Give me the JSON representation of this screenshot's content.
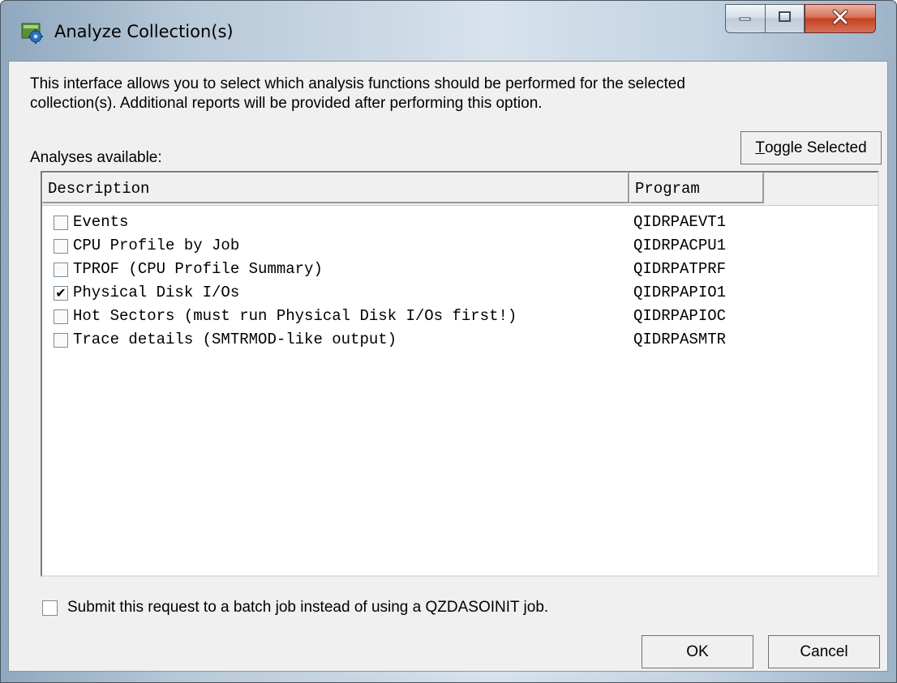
{
  "window": {
    "title": "Analyze Collection(s)",
    "icon": "analyze-gear-icon"
  },
  "caption_buttons": {
    "minimize": "minimize-icon",
    "maximize": "maximize-icon",
    "close": "close-icon"
  },
  "intro": {
    "line1": "This interface allows you to select which analysis functions should be performed for the selected",
    "line2": "collection(s).  Additional reports will be provided after performing this option."
  },
  "analyses_label": "Analyses available:",
  "toggle_button": {
    "underline": "T",
    "rest": "oggle Selected"
  },
  "list": {
    "columns": [
      "Description",
      "Program"
    ],
    "rows": [
      {
        "checked": false,
        "description": "Events",
        "program": "QIDRPAEVT1"
      },
      {
        "checked": false,
        "description": "CPU Profile by Job",
        "program": "QIDRPACPU1"
      },
      {
        "checked": false,
        "description": "TPROF (CPU Profile Summary)",
        "program": "QIDRPATPRF"
      },
      {
        "checked": true,
        "description": "Physical Disk I/Os",
        "program": "QIDRPAPIO1"
      },
      {
        "checked": false,
        "description": "Hot Sectors (must run Physical Disk I/Os first!)",
        "program": "QIDRPAPIOC"
      },
      {
        "checked": false,
        "description": "Trace details (SMTRMOD-like output)",
        "program": "QIDRPASMTR"
      }
    ]
  },
  "batch_option": {
    "checked": false,
    "label": "Submit this request to a batch job instead of using a QZDASOINIT job."
  },
  "buttons": {
    "ok": "OK",
    "cancel": "Cancel"
  }
}
